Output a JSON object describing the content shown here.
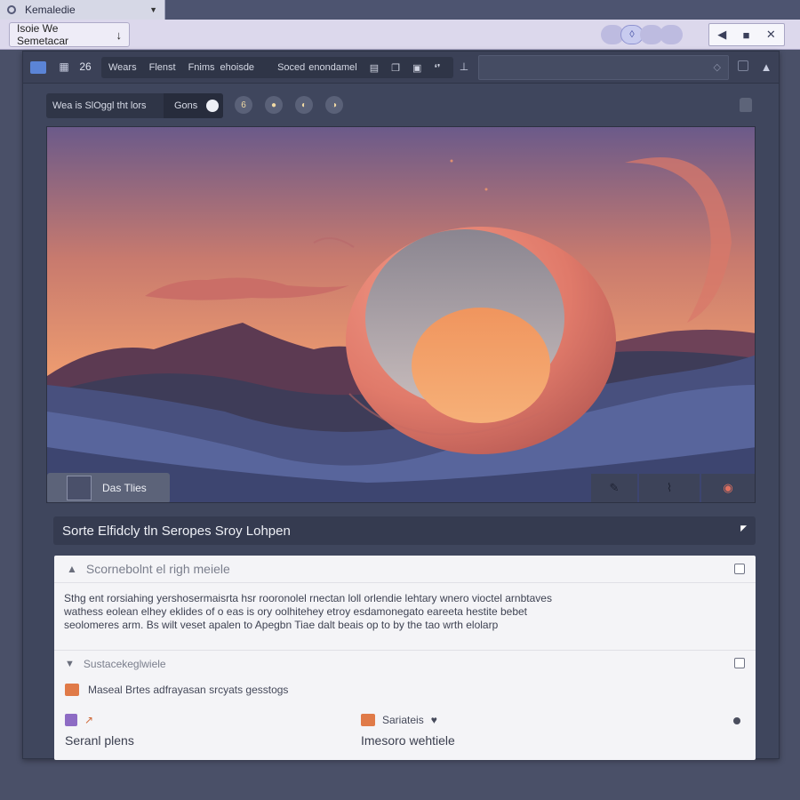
{
  "window": {
    "tab_title": "Kemaledie",
    "address_label": "Isoie We Semetacar",
    "address_arrow": "↓"
  },
  "toolbar": {
    "number": "26",
    "menu_items": [
      "Wears",
      "Flenst",
      "Fnims",
      "ehoisde",
      "Soced",
      "enondamel"
    ]
  },
  "filterbar": {
    "search_text": "Wea is SlOggl tht lors",
    "button_label": "Gons"
  },
  "canvas": {
    "layer_label": "Das Tlies"
  },
  "panel": {
    "title": "Sorte Elfidcly tln Seropes Sroy Lohpen"
  },
  "card": {
    "row1_placeholder": "Scornebolnt el righ meiele",
    "paragraph": [
      "Sthg ent rorsiahing yershosermaisrta hsr rooronolel rnectan loll orlendie lehtary wnero vioctel arnbtaves",
      "wathess eolean elhey eklides of o eas is ory oolhitehey etroy esdamonegato eareeta hestite bebet",
      "seolomeres arm. Bs wilt veset apalen to Apegbn Tiae dalt beais op to by the tao wrth elolarp"
    ],
    "row2_label": "Sustacekeglwiele",
    "row3_label": "Maseal Brtes adfrayasan srcyats gesstogs",
    "col1_top_icon": "↗",
    "col1_label": "Seranl plens",
    "col2_top_label": "Sariateis",
    "col2_top_icon": "♥",
    "col2_label": "Imesoro wehtiele"
  },
  "colors": {
    "accent_blue": "#5b84d6",
    "coral": "#e8806a",
    "sky_top": "#6b5a8a",
    "sky_bottom": "#f2a070",
    "orange_square": "#e07a48",
    "purple_square": "#8d6bc4"
  },
  "icons": {
    "tab": "circle-icon",
    "close": "close-icon",
    "back": "back-icon"
  }
}
